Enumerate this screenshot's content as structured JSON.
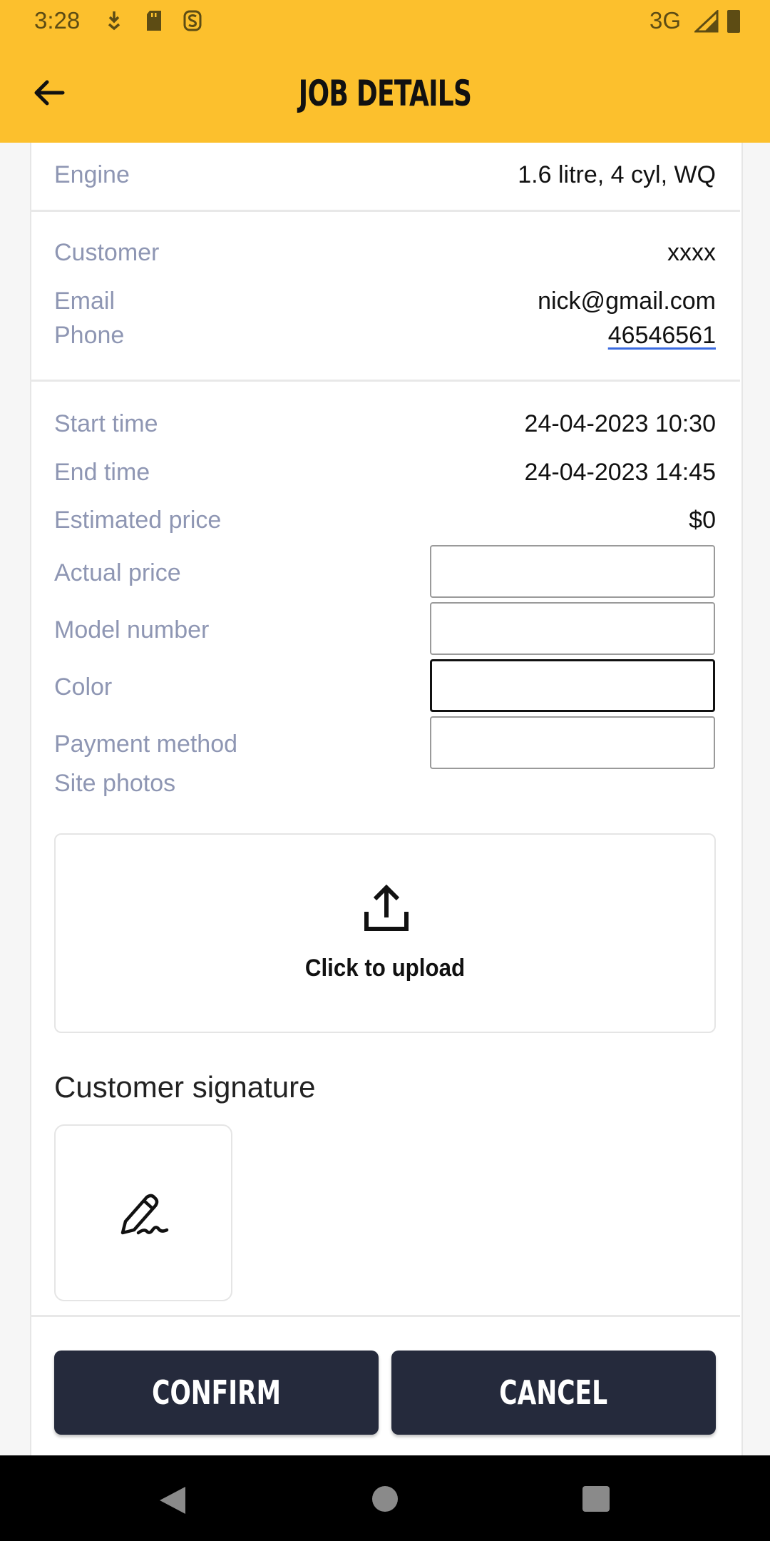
{
  "status_bar": {
    "time": "3:28",
    "network": "3G"
  },
  "app_bar": {
    "title": "JOB DETAILS"
  },
  "vehicle": {
    "engine_label": "Engine",
    "engine_value": "1.6 litre, 4 cyl, WQ"
  },
  "customer": {
    "customer_label": "Customer",
    "customer_value": "xxxx",
    "email_label": "Email",
    "email_value": "nick@gmail.com",
    "phone_label": "Phone",
    "phone_value": "46546561"
  },
  "job": {
    "start_label": "Start time",
    "start_value": "24-04-2023 10:30",
    "end_label": "End time",
    "end_value": "24-04-2023 14:45",
    "estimated_price_label": "Estimated price",
    "estimated_price_value": "$0",
    "actual_price_label": "Actual price",
    "actual_price_value": "",
    "model_number_label": "Model number",
    "model_number_value": "",
    "color_label": "Color",
    "color_value": "",
    "payment_method_label": "Payment method",
    "payment_method_value": "",
    "site_photos_label": "Site photos"
  },
  "upload": {
    "label": "Click to upload",
    "icon": "upload-icon"
  },
  "signature": {
    "title": "Customer signature",
    "icon": "pen-signature-icon"
  },
  "actions": {
    "confirm_label": "CONFIRM",
    "cancel_label": "CANCEL"
  },
  "colors": {
    "accent": "#FCC02D",
    "button": "#252a3c",
    "label": "#8e96b3"
  }
}
